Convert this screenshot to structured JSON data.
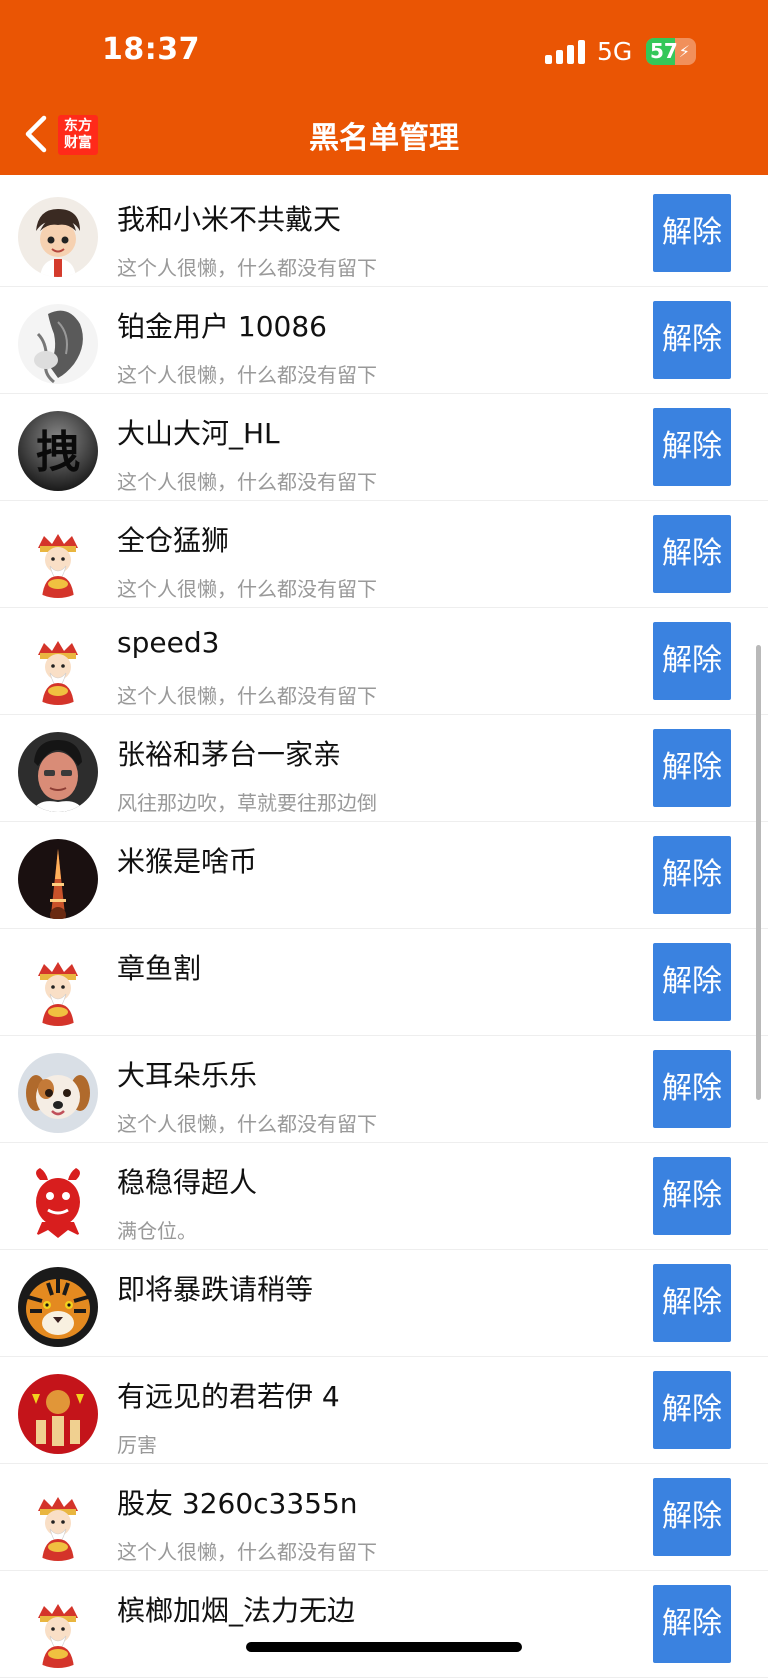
{
  "status_bar": {
    "time": "18:37",
    "network": "5G",
    "battery": "57",
    "battery_level": 0.57
  },
  "nav": {
    "back_icon": "chevron-left-icon",
    "logo_text_line1": "东方",
    "logo_text_line2": "财富",
    "title": "黑名单管理"
  },
  "action_label": "解除",
  "users": [
    {
      "name": "我和小米不共戴天",
      "bio": "这个人很懒，什么都没有留下",
      "avatar": "cartoon-boy-avatar"
    },
    {
      "name": "铂金用户 10086",
      "bio": "这个人很懒，什么都没有留下",
      "avatar": "sketch-avatar"
    },
    {
      "name": "大山大河_HL",
      "bio": "这个人很懒，什么都没有留下",
      "avatar": "calligraphy-avatar"
    },
    {
      "name": "全仓猛狮",
      "bio": "这个人很懒，什么都没有留下",
      "avatar": "default-mascot-avatar"
    },
    {
      "name": "speed3",
      "bio": "这个人很懒，什么都没有留下",
      "avatar": "default-mascot-avatar"
    },
    {
      "name": "张裕和茅台一家亲",
      "bio": "风往那边吹，草就要往那边倒",
      "avatar": "man-photo-avatar"
    },
    {
      "name": "米猴是啥币",
      "bio": "",
      "avatar": "tower-night-avatar"
    },
    {
      "name": "章鱼割",
      "bio": "",
      "avatar": "default-mascot-avatar"
    },
    {
      "name": "大耳朵乐乐",
      "bio": "这个人很懒，什么都没有留下",
      "avatar": "puppy-avatar"
    },
    {
      "name": "稳稳得超人",
      "bio": "满仓位。",
      "avatar": "red-papercut-avatar"
    },
    {
      "name": "即将暴跌请稍等",
      "bio": "",
      "avatar": "tiger-avatar"
    },
    {
      "name": "有远见的君若伊 4",
      "bio": "厉害",
      "avatar": "red-festive-avatar"
    },
    {
      "name": "股友 3260c3355n",
      "bio": "这个人很懒，什么都没有留下",
      "avatar": "default-mascot-avatar"
    },
    {
      "name": "槟榔加烟_法力无边",
      "bio": "",
      "avatar": "default-mascot-avatar"
    }
  ],
  "colors": {
    "header": "#ea5504",
    "button": "#3a82e0",
    "battery_green": "#34c759",
    "brand_red": "#ff2a1a"
  }
}
